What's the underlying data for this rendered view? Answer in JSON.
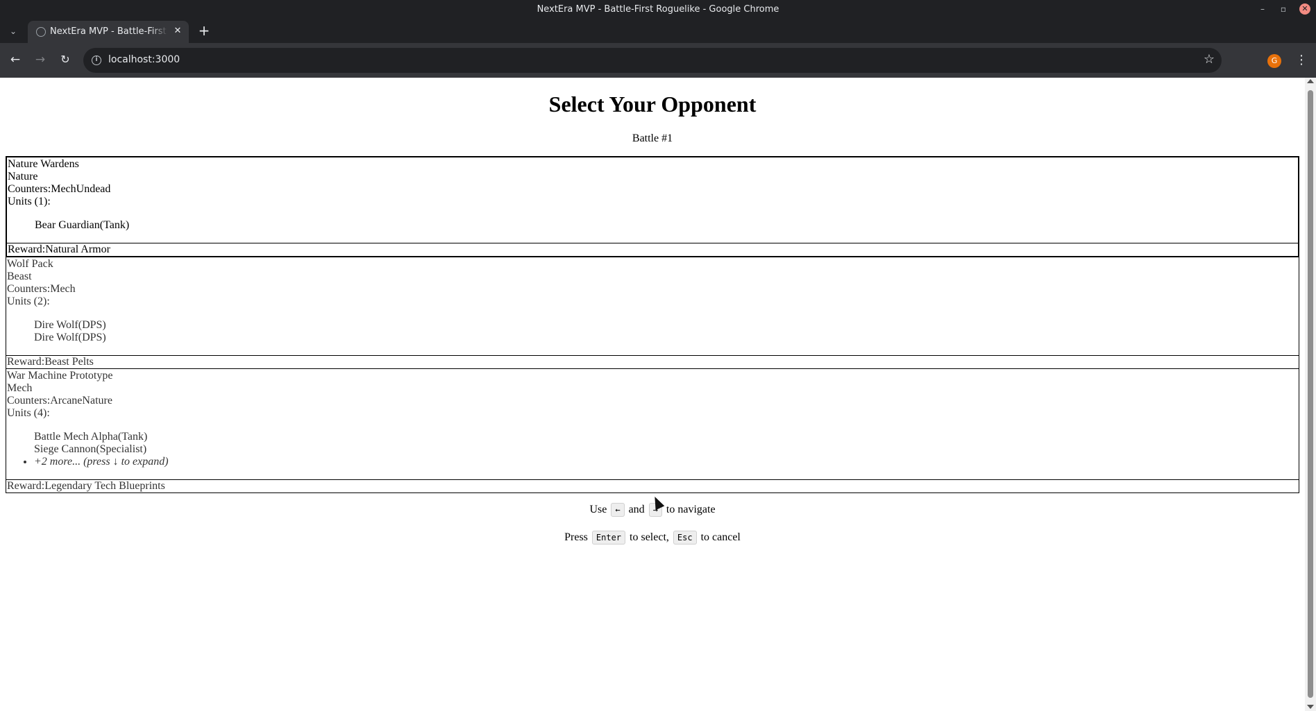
{
  "window": {
    "title": "NextEra MVP - Battle-First Roguelike - Google Chrome",
    "controls": {
      "minimize": "–",
      "maximize": "▫",
      "close": "✕"
    }
  },
  "tabs": [
    {
      "title": "NextEra MVP - Battle-First Roguelike",
      "close": "✕"
    }
  ],
  "tabstrip": {
    "list_icon": "⌄",
    "new_tab": "+"
  },
  "toolbar": {
    "back": "←",
    "forward": "→",
    "reload": "↻",
    "url": "localhost:3000",
    "info_icon": "i",
    "bookmark_icon": "☆",
    "profile_initial": "G",
    "menu_icon": "⋮"
  },
  "page": {
    "title": "Select Your Opponent",
    "battle_label": "Battle #1"
  },
  "opponents": [
    {
      "name": "Nature Wardens",
      "faction": "Nature",
      "counters_label": "Counters:",
      "counters": "MechUndead",
      "units_label": "Units (1):",
      "units": [
        "Bear Guardian(Tank)"
      ],
      "more": "",
      "reward_label": "Reward:",
      "reward": "Natural Armor"
    },
    {
      "name": "Wolf Pack",
      "faction": "Beast",
      "counters_label": "Counters:",
      "counters": "Mech",
      "units_label": "Units (2):",
      "units": [
        "Dire Wolf(DPS)",
        "Dire Wolf(DPS)"
      ],
      "more": "",
      "reward_label": "Reward:",
      "reward": "Beast Pelts"
    },
    {
      "name": "War Machine Prototype",
      "faction": "Mech",
      "counters_label": "Counters:",
      "counters": "ArcaneNature",
      "units_label": "Units (4):",
      "units": [
        "Battle Mech Alpha(Tank)",
        "Siege Cannon(Specialist)"
      ],
      "more": "+2 more... (press ↓ to expand)",
      "reward_label": "Reward:",
      "reward": "Legendary Tech Blueprints"
    }
  ],
  "hints": {
    "nav_use": "Use",
    "nav_left_key": "←",
    "nav_and": "and",
    "nav_right_key": "→",
    "nav_suffix": "to navigate",
    "press": "Press",
    "enter_key": "Enter",
    "to_select": "to select,",
    "esc_key": "Esc",
    "to_cancel": "to cancel"
  }
}
